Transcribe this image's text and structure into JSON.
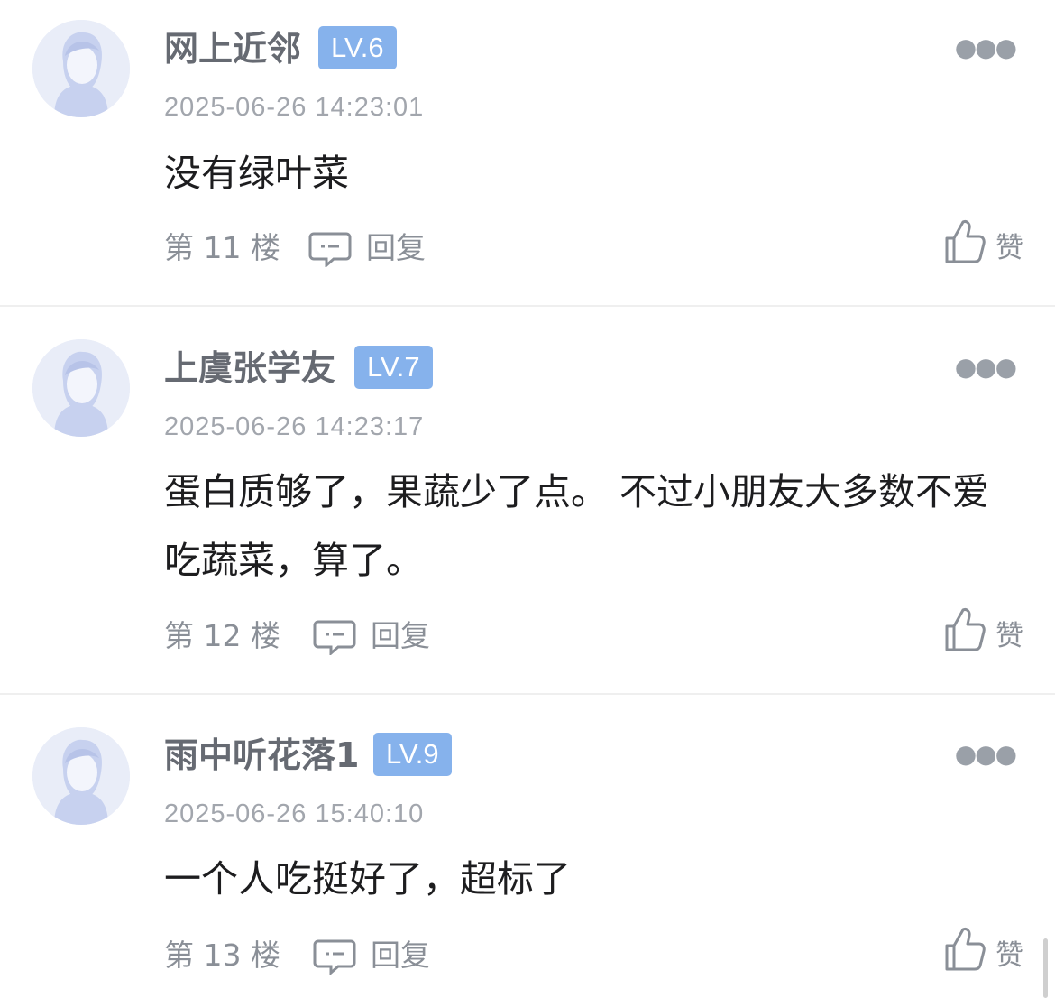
{
  "comments": [
    {
      "username": "网上近邻",
      "level": "LV.6",
      "time": "2025-06-26 14:23:01",
      "text": "没有绿叶菜",
      "floor": "第 11 楼",
      "reply": "回复",
      "like": "赞"
    },
    {
      "username": "上虞张学友",
      "level": "LV.7",
      "time": "2025-06-26 14:23:17",
      "text": "蛋白质够了，果蔬少了点。 不过小朋友大多数不爱吃蔬菜，算了。",
      "floor": "第 12 楼",
      "reply": "回复",
      "like": "赞"
    },
    {
      "username": "雨中听花落1",
      "level": "LV.9",
      "time": "2025-06-26 15:40:10",
      "text": "一个人吃挺好了，超标了",
      "floor": "第 13 楼",
      "reply": "回复",
      "like": "赞"
    }
  ],
  "more_icon": "more-dots-icon",
  "reply_icon": "chat-bubble-icon",
  "like_icon": "thumbs-up-icon",
  "colors": {
    "level_badge": "#86b2ec",
    "username": "#666a72",
    "meta": "#a2a6ad",
    "body_text": "#1d1d1f"
  }
}
